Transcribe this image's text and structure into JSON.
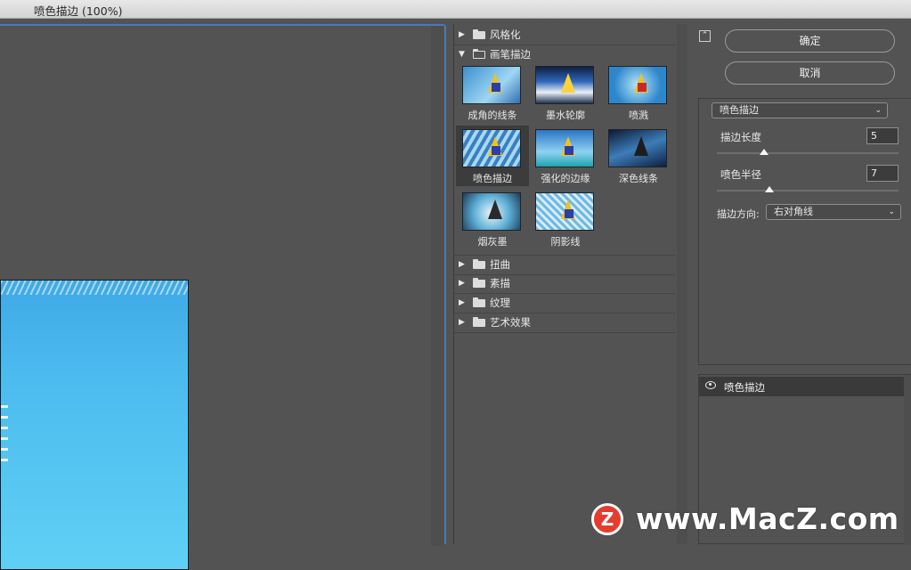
{
  "window": {
    "title": "喷色描边 (100%)"
  },
  "filter_browser": {
    "categories_top": [
      {
        "label": "风格化",
        "expanded": false
      },
      {
        "label": "画笔描边",
        "expanded": true
      }
    ],
    "thumbnails": [
      {
        "label": "成角的线条",
        "selected": false
      },
      {
        "label": "墨水轮廓",
        "selected": false
      },
      {
        "label": "喷溅",
        "selected": false
      },
      {
        "label": "喷色描边",
        "selected": true
      },
      {
        "label": "强化的边缘",
        "selected": false
      },
      {
        "label": "深色线条",
        "selected": false
      },
      {
        "label": "烟灰墨",
        "selected": false
      },
      {
        "label": "阴影线",
        "selected": false
      }
    ],
    "categories_bottom": [
      {
        "label": "扭曲"
      },
      {
        "label": "素描"
      },
      {
        "label": "纹理"
      },
      {
        "label": "艺术效果"
      }
    ]
  },
  "settings": {
    "ok_label": "确定",
    "cancel_label": "取消",
    "filter_select": "喷色描边",
    "params": [
      {
        "label": "描边长度",
        "value": "5",
        "slider_fraction": 0.24
      },
      {
        "label": "喷色半径",
        "value": "7",
        "slider_fraction": 0.28
      }
    ],
    "direction_label": "描边方向:",
    "direction_value": "右对角线"
  },
  "layers": {
    "items": [
      {
        "label": "喷色描边",
        "visible": true
      }
    ]
  },
  "watermark": {
    "logo": "Z",
    "text": "www.MacZ.com"
  },
  "colors": {
    "accent_border": "#4a79b8",
    "panel_bg": "#535353",
    "watermark_red": "#e53c2e"
  }
}
